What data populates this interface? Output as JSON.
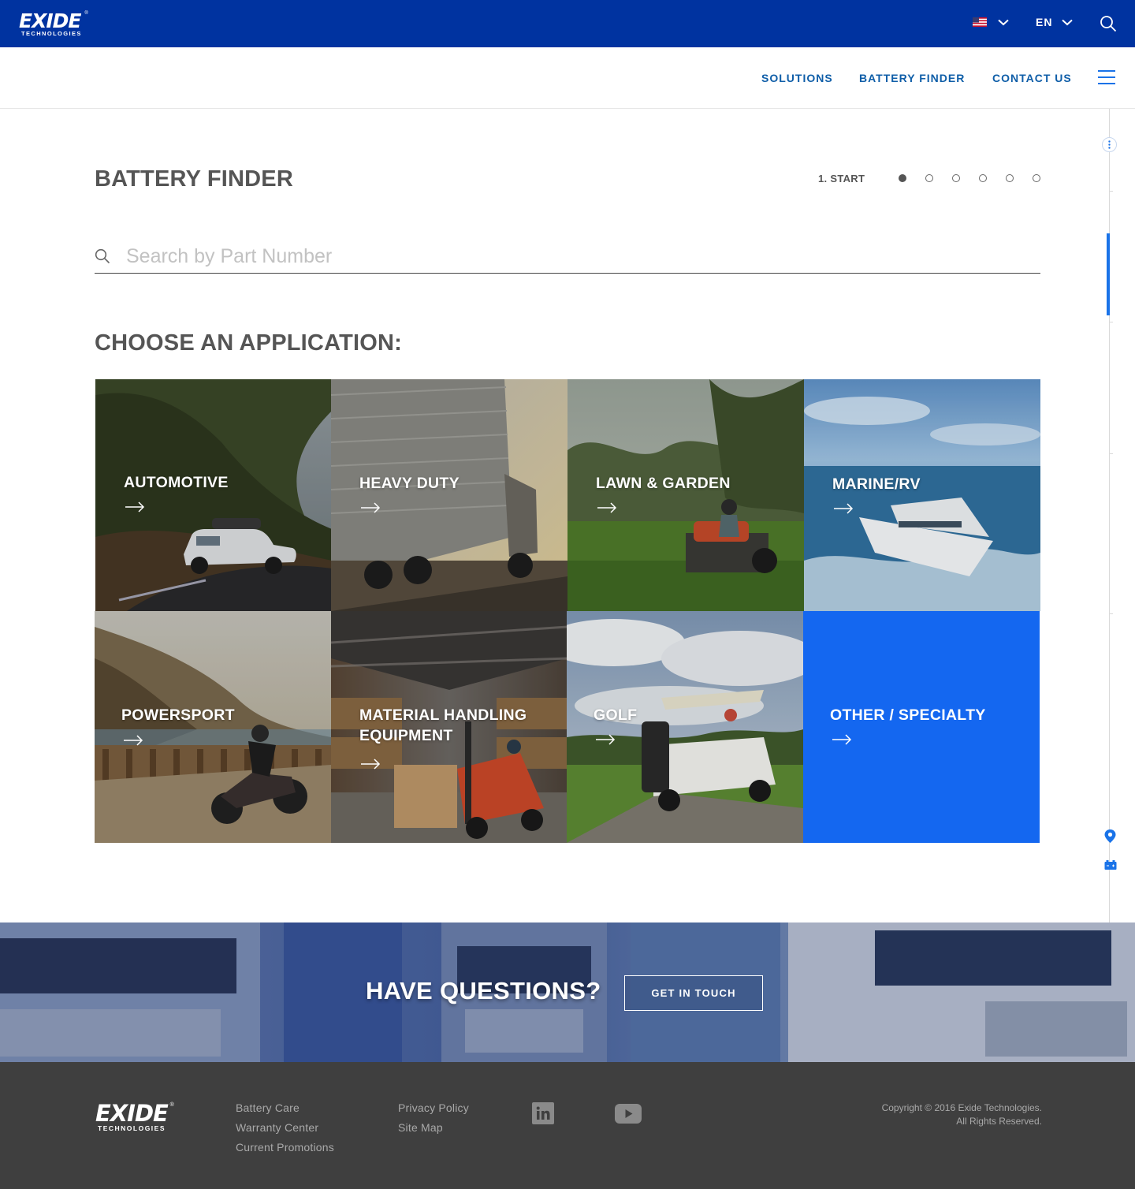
{
  "brand": {
    "logo_word": "EXIDE",
    "logo_sub": "TECHNOLOGIES",
    "logo_reg": "®"
  },
  "topbar": {
    "background": "#0033a0",
    "country_flag": "us-flag-icon",
    "language": "EN"
  },
  "nav": {
    "items": [
      {
        "label": "SOLUTIONS"
      },
      {
        "label": "BATTERY FINDER"
      },
      {
        "label": "CONTACT US"
      }
    ],
    "accent": "#0f5ea8"
  },
  "finder": {
    "title": "BATTERY FINDER",
    "step_label": "1. START",
    "steps_total": 6,
    "current_step": 1,
    "search_placeholder": "Search by Part Number",
    "search_value": "",
    "section_title": "CHOOSE AN APPLICATION:",
    "applications": [
      {
        "label": "AUTOMOTIVE"
      },
      {
        "label": "HEAVY DUTY"
      },
      {
        "label": "LAWN & GARDEN"
      },
      {
        "label": "MARINE/RV"
      },
      {
        "label": "POWERSPORT"
      },
      {
        "label_line1": "MATERIAL HANDLING",
        "label_line2": "EQUIPMENT"
      },
      {
        "label": "GOLF"
      },
      {
        "label": "OTHER / SPECIALTY"
      }
    ],
    "specialty_color": "#1467f0"
  },
  "cta": {
    "title": "HAVE QUESTIONS?",
    "button": "GET IN TOUCH"
  },
  "footer": {
    "col1": [
      "Battery Care",
      "Warranty Center",
      "Current Promotions"
    ],
    "col2": [
      "Privacy Policy",
      "Site Map"
    ],
    "social": [
      "linkedin-icon",
      "youtube-icon"
    ],
    "copyright_line1": "Copyright © 2016 Exide Technologies.",
    "copyright_line2": "All Rights Reserved."
  }
}
